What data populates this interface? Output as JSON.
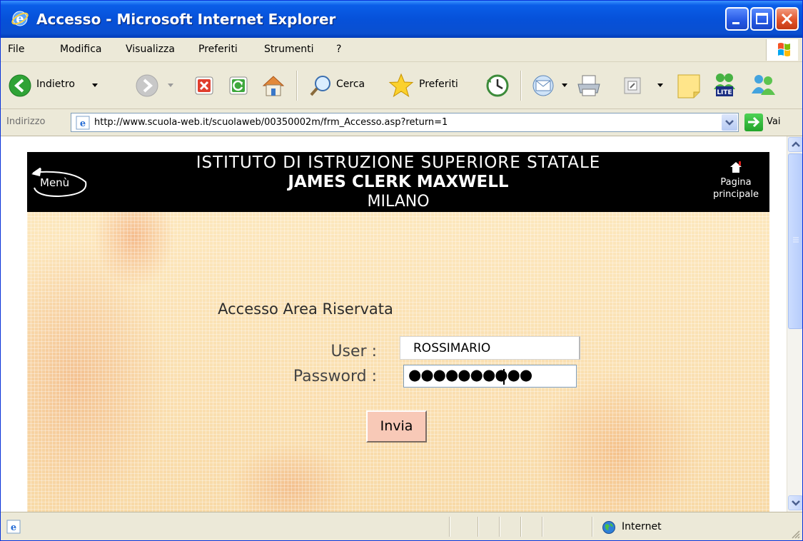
{
  "window": {
    "title": "Accesso - Microsoft Internet Explorer"
  },
  "menubar": {
    "items": [
      "File",
      "Modifica",
      "Visualizza",
      "Preferiti",
      "Strumenti",
      "?"
    ]
  },
  "toolbar": {
    "back_label": "Indietro",
    "search_label": "Cerca",
    "favorites_label": "Preferiti"
  },
  "addressbar": {
    "label": "Indirizzo",
    "url": "http://www.scuola-web.it/scuolaweb/00350002m/frm_Accesso.asp?return=1",
    "go_label": "Vai"
  },
  "page": {
    "banner": {
      "line1": "ISTITUTO DI ISTRUZIONE SUPERIORE STATALE",
      "line2": "JAMES CLERK MAXWELL",
      "line3": "MILANO",
      "menu_label": "Menù",
      "home_label_1": "Pagina",
      "home_label_2": "principale"
    },
    "form": {
      "title": "Accesso Area Riservata",
      "user_label": "User :",
      "password_label": "Password :",
      "user_value": "ROSSIMARIO",
      "password_value": "●●●●●●●●●●",
      "submit_label": "Invia"
    }
  },
  "statusbar": {
    "zone": "Internet"
  }
}
